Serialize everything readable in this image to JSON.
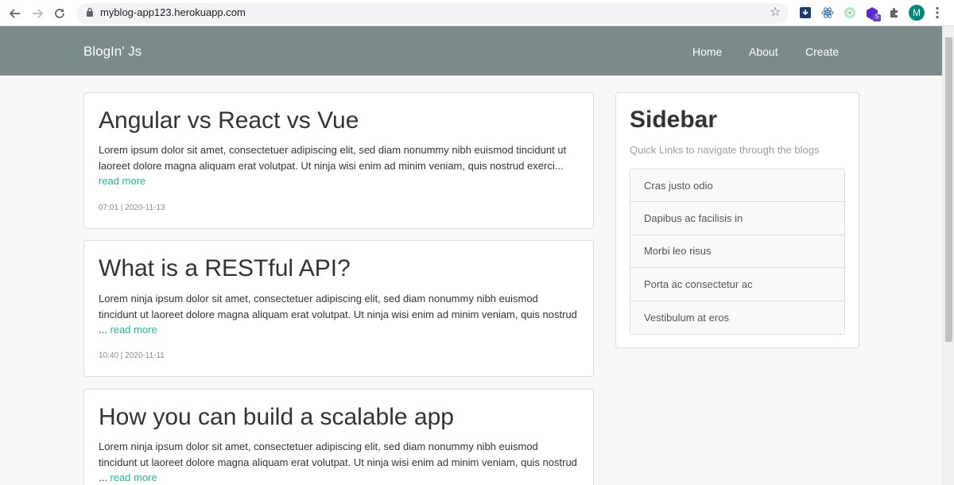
{
  "browser": {
    "url": "myblog-app123.herokuapp.com",
    "avatar_letter": "M",
    "extension_badge": "5"
  },
  "site": {
    "brand": "BlogIn' Js",
    "nav": [
      "Home",
      "About",
      "Create"
    ]
  },
  "posts": [
    {
      "title": "Angular vs React vs Vue",
      "excerpt": "Lorem ipsum dolor sit amet, consectetuer adipiscing elit, sed diam nonummy nibh euismod tincidunt ut laoreet dolore magna aliquam erat volutpat. Ut ninja wisi enim ad minim veniam, quis nostrud exerci...",
      "read_more": "read more",
      "meta": "07:01 | 2020-11-13"
    },
    {
      "title": "What is a RESTful API?",
      "excerpt": "Lorem ninja ipsum dolor sit amet, consectetuer adipiscing elit, sed diam nonummy nibh euismod tincidunt ut laoreet dolore magna aliquam erat volutpat. Ut ninja wisi enim ad minim veniam, quis nostrud ...",
      "read_more": "read more",
      "meta": "10:40 | 2020-11-11"
    },
    {
      "title": "How you can build a scalable app",
      "excerpt": "Lorem ninja ipsum dolor sit amet, consectetuer adipiscing elit, sed diam nonummy nibh euismod tincidunt ut laoreet dolore magna aliquam erat volutpat. Ut ninja wisi enim ad minim veniam, quis nostrud ...",
      "read_more": "read more",
      "meta": ""
    }
  ],
  "sidebar": {
    "title": "Sidebar",
    "subtitle": "Quick Links to navigate through the blogs",
    "links": [
      "Cras justo odio",
      "Dapibus ac facilisis in",
      "Morbi leo risus",
      "Porta ac consectetur ac",
      "Vestibulum at eros"
    ]
  },
  "colors": {
    "navbar": "#7b8a8b",
    "link_accent": "#26b89a",
    "avatar": "#00897b"
  }
}
